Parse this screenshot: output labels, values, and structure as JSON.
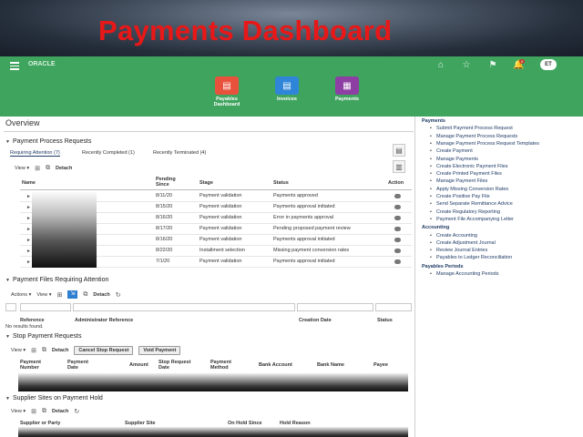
{
  "hero_title": "Payments Dashboard",
  "brand": "ORACLE",
  "topbar": {
    "avatar": "ET",
    "badge": "9",
    "icons": [
      "home-icon",
      "star-icon",
      "flag-icon",
      "notification-icon"
    ]
  },
  "tiles": [
    {
      "label": "Payables Dashboard",
      "color": "#e8523d",
      "icon": "▤"
    },
    {
      "label": "Invoices",
      "color": "#2f86d8",
      "icon": "▤"
    },
    {
      "label": "Payments",
      "color": "#8d3fa3",
      "icon": "▦"
    }
  ],
  "overview": "Overview",
  "ppr": {
    "title": "Payment Process Requests",
    "tabs": [
      "Requiring Attention (7)",
      "Recently Completed (1)",
      "Recently Terminated (4)"
    ],
    "view": "View",
    "detach": "Detach",
    "headers": [
      "Name",
      "Pending Since",
      "Stage",
      "Status",
      "Action"
    ],
    "rows": [
      {
        "date": "8/11/20",
        "stage": "Payment validation",
        "status": "Payments approved"
      },
      {
        "date": "8/15/20",
        "stage": "Payment validation",
        "status": "Payments approval initiated"
      },
      {
        "date": "8/16/20",
        "stage": "Payment validation",
        "status": "Error in payments approval"
      },
      {
        "date": "8/17/20",
        "stage": "Payment validation",
        "status": "Pending proposed payment review"
      },
      {
        "date": "8/16/20",
        "stage": "Payment validation",
        "status": "Payments approval initiated"
      },
      {
        "date": "8/22/20",
        "stage": "Installment selection",
        "status": "Missing payment conversion rates"
      },
      {
        "date": "7/1/20",
        "stage": "Payment validation",
        "status": "Payments approval initiated"
      }
    ]
  },
  "pfra": {
    "title": "Payment Files Requiring Attention",
    "actions": "Actions",
    "view": "View",
    "detach": "Detach",
    "headers": [
      "Reference",
      "Administrator Reference",
      "Creation Date",
      "Status"
    ],
    "empty": "No results found."
  },
  "spr": {
    "title": "Stop Payment Requests",
    "view": "View",
    "detach": "Detach",
    "cancel_btn": "Cancel Stop Request",
    "void_btn": "Void Payment",
    "headers": [
      "Payment Number",
      "Payment Date",
      "Amount",
      "Stop Request Date",
      "Payment Method",
      "Bank Account",
      "Bank Name",
      "Payee"
    ]
  },
  "ssph": {
    "title": "Supplier Sites on Payment Hold",
    "view": "View",
    "detach": "Detach",
    "headers": [
      "Supplier or Party",
      "Supplier Site",
      "On Hold Since",
      "Hold Reason"
    ]
  },
  "side": {
    "payments_title": "Payments",
    "payments": [
      "Submit Payment Process Request",
      "Manage Payment Process Requests",
      "Manage Payment Process Request Templates",
      "Create Payment",
      "Manage Payments",
      "Create Electronic Payment Files",
      "Create Printed Payment Files",
      "Manage Payment Files",
      "Apply Missing Conversion Rates",
      "Create Positive Pay File",
      "Send Separate Remittance Advice",
      "Create Regulatory Reporting",
      "Payment File Accompanying Letter"
    ],
    "accounting_title": "Accounting",
    "accounting": [
      "Create Accounting",
      "Create Adjustment Journal",
      "Review Journal Entries",
      "Payables to Ledger Reconciliation"
    ],
    "periods_title": "Payables Periods",
    "periods": [
      "Manage Accounting Periods"
    ]
  }
}
